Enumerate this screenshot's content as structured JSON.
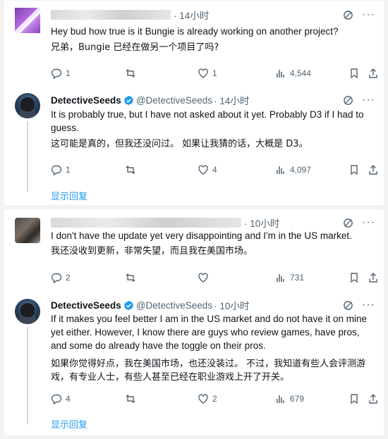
{
  "thread1": {
    "tweet1": {
      "time": "· 14小时",
      "text": "Hey bud how true is it Bungie is already working on another project?",
      "translation": "兄弟，Bungie 已经在做另一个项目了吗?",
      "stats": {
        "replies": "1",
        "retweets": "",
        "likes": "1",
        "views": "4,544"
      }
    },
    "tweet2": {
      "name": "DetectiveSeeds",
      "handle": "@DetectiveSeeds",
      "time": "· 14小时",
      "text": "It is probably true, but I have not asked about it yet.  Probably D3 if I had to guess.",
      "translation": "这可能是真的，但我还没问过。 如果让我猜的话，大概是 D3。",
      "stats": {
        "replies": "1",
        "retweets": "",
        "likes": "4",
        "views": "4,097"
      }
    },
    "show_replies": "显示回复"
  },
  "thread2": {
    "tweet1": {
      "time": "· 10小时",
      "text": "I don't have the update yet very disappointing and I'm in the US market.",
      "translation": "我还没收到更新，非常失望，而且我在美国市场。",
      "stats": {
        "replies": "2",
        "retweets": "",
        "likes": "",
        "views": "731"
      }
    },
    "tweet2": {
      "name": "DetectiveSeeds",
      "handle": "@DetectiveSeeds",
      "time": "· 10小时",
      "text_lines": [
        "If it makes you feel better I am in the US market and do not have it on mine",
        "yet either.  However, I know there are guys who review games, have pros,",
        "and some do already have the toggle on their pros."
      ],
      "translation_lines": [
        "如果你觉得好点，我在美国市场，也还没装过。 不过，我知道有些人会评测游",
        "戏，有专业人士，有些人甚至已经在职业游戏上开了开关。"
      ],
      "stats": {
        "replies": "4",
        "retweets": "",
        "likes": "2",
        "views": "679"
      }
    },
    "show_replies": "显示回复"
  },
  "colors": {
    "accent": "#1d9bf0",
    "muted": "#536471",
    "verified": "#1d9bf0"
  }
}
